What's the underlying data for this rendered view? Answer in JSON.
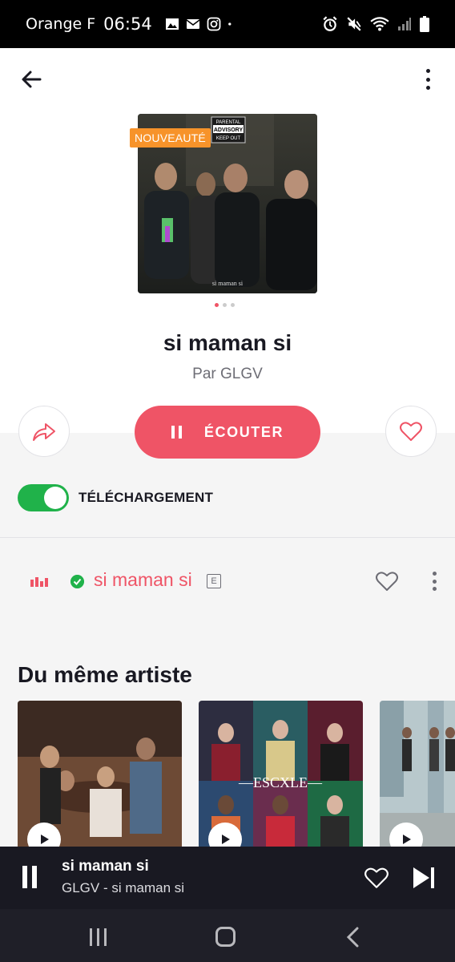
{
  "status_bar": {
    "carrier": "Orange F",
    "time": "06:54",
    "left_icons": [
      "image-icon",
      "mail-icon",
      "instagram-icon",
      "dot-icon"
    ],
    "right_icons": [
      "alarm-icon",
      "mute-icon",
      "wifi-icon",
      "signal-icon",
      "battery-icon"
    ]
  },
  "header": {
    "back_icon": "arrow-left-icon",
    "more_icon": "vertical-dots-icon"
  },
  "album": {
    "badge": "NOUVEAUTÉ",
    "title": "si maman si",
    "artist_line": "Par GLGV",
    "cover_caption": "si maman si",
    "advisory_line1": "PARENTAL",
    "advisory_line2": "ADVISORY",
    "advisory_line3": "KEEP OUT",
    "carousel_dots_total": 3,
    "carousel_dot_active": 1
  },
  "actions": {
    "share_icon": "share-arrow-icon",
    "listen_label": "ÉCOUTER",
    "favorite_icon": "heart-outline-icon"
  },
  "download": {
    "label": "TÉLÉCHARGEMENT",
    "enabled": true
  },
  "tracks": [
    {
      "title": "si maman si",
      "explicit_badge": "E",
      "playing": true,
      "downloaded": true
    }
  ],
  "related": {
    "section_title": "Du même artiste",
    "cards": [
      {
        "name": "album-card-1"
      },
      {
        "name": "album-card-2",
        "cover_text": "—ESCXLE—"
      },
      {
        "name": "album-card-3"
      }
    ]
  },
  "mini_player": {
    "title": "si maman si",
    "subtitle": "GLGV - si maman si"
  },
  "colors": {
    "accent": "#ef5466",
    "toggle_on": "#20b24a",
    "badge": "#f7932a",
    "player_bg": "#191922"
  }
}
